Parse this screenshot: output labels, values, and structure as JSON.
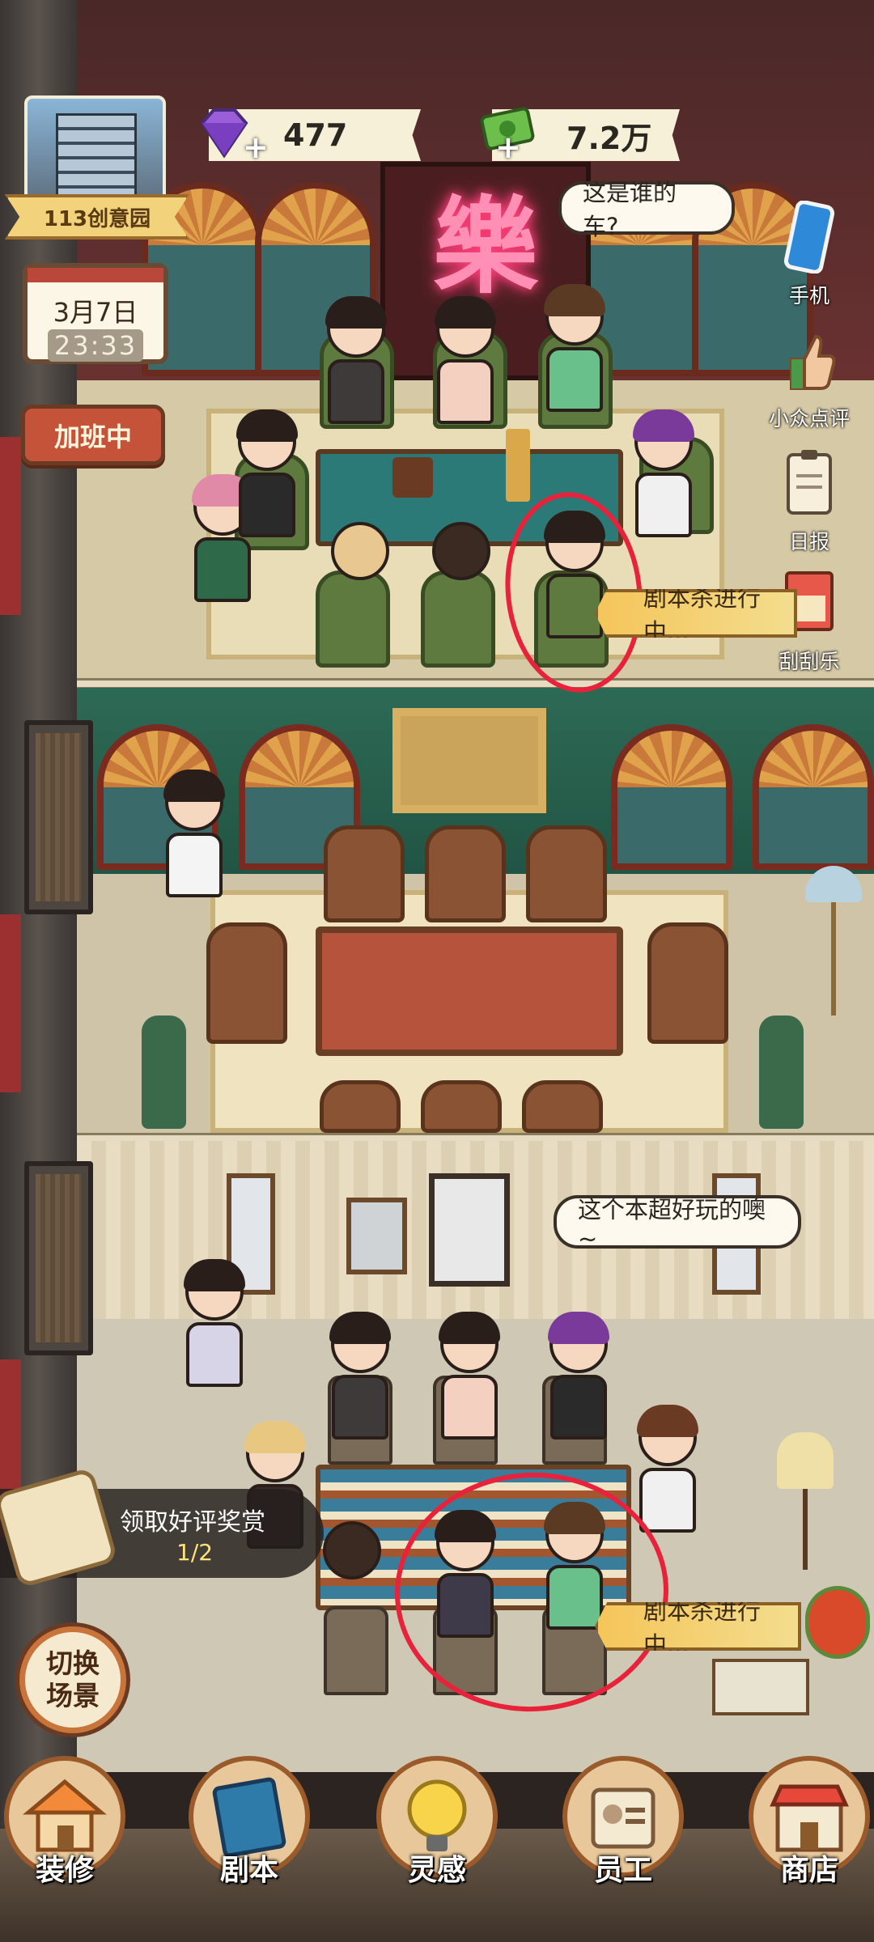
{
  "hud": {
    "building_name": "113创意园",
    "date": "3月7日",
    "time": "23:33",
    "overtime_button": "加班中",
    "gems": "477",
    "money": "7.2万",
    "plus": "+"
  },
  "bubbles": {
    "top": "这是谁的车?",
    "bottom": "这个本超好玩的噢~"
  },
  "side_menu": [
    {
      "label": "手机",
      "icon": "phone-icon"
    },
    {
      "label": "小众点评",
      "icon": "thumbs-up-icon"
    },
    {
      "label": "日报",
      "icon": "clipboard-icon"
    },
    {
      "label": "刮刮乐",
      "icon": "scratch-card-icon"
    }
  ],
  "status_banners": {
    "floor1": "剧本杀进行中...",
    "floor3": "剧本杀进行中..."
  },
  "reward": {
    "label": "领取好评奖赏",
    "progress": "1/2"
  },
  "switch_scene": "切换场景",
  "nav": [
    {
      "label": "装修",
      "icon": "house-icon"
    },
    {
      "label": "剧本",
      "icon": "script-book-icon"
    },
    {
      "label": "灵感",
      "icon": "lightbulb-icon"
    },
    {
      "label": "员工",
      "icon": "staff-badge-icon"
    },
    {
      "label": "商店",
      "icon": "shop-icon"
    }
  ],
  "colors": {
    "highlight_circle": "#e8223a",
    "neon_sign": "#ff8fb4"
  }
}
